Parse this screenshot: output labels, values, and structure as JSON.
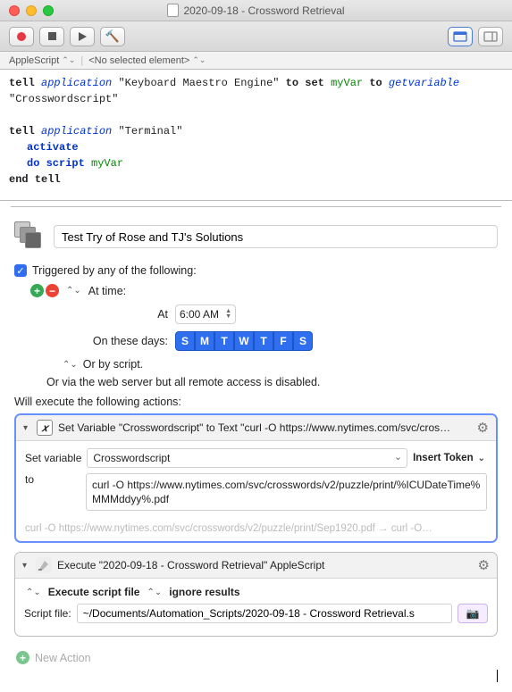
{
  "titlebar": {
    "title": "2020-09-18 - Crossword Retrieval"
  },
  "nav": {
    "language": "AppleScript",
    "element": "<No selected element>"
  },
  "script": {
    "l1_tell": "tell",
    "l1_app": "application",
    "l1_q": "\"Keyboard Maestro Engine\"",
    "l1_to": "to set",
    "l1_var": "myVar",
    "l1_to2": "to",
    "l1_getvar": "getvariable",
    "l1_q2": "\"Crosswordscript\"",
    "l3_tell": "tell",
    "l3_app": "application",
    "l3_q": "\"Terminal\"",
    "l4_activate": "activate",
    "l5_do": "do script",
    "l5_var": "myVar",
    "l6_end": "end tell"
  },
  "macro": {
    "name": "Test Try of Rose and TJ's Solutions",
    "triggered_label": "Triggered by any of the following:",
    "at_time_label": "At time:",
    "at_label": "At",
    "time_value": "6:00 AM",
    "days_label": "On these days:",
    "days": [
      "S",
      "M",
      "T",
      "W",
      "T",
      "F",
      "S"
    ],
    "or_script_label": "Or by script.",
    "web_label": "Or via the web server but all remote access is disabled.",
    "will_execute": "Will execute the following actions:"
  },
  "action1": {
    "title": "Set Variable \"Crosswordscript\" to Text \"curl -O https://www.nytimes.com/svc/cros…",
    "set_var_label": "Set variable",
    "var_name": "Crosswordscript",
    "insert_token": "Insert Token",
    "to_label": "to",
    "text_value": "curl -O https://www.nytimes.com/svc/crosswords/v2/puzzle/print/%ICUDateTime%MMMddyy%.pdf",
    "preview_left": "curl -O https://www.nytimes.com/svc/crosswords/v2/puzzle/print/Sep1920.pdf",
    "preview_right": "curl -O…"
  },
  "action2": {
    "title": "Execute \"2020-09-18 - Crossword Retrieval\" AppleScript",
    "execute_label": "Execute script file",
    "results_label": "ignore results",
    "file_label": "Script file:",
    "file_value": "~/Documents/Automation_Scripts/2020-09-18 - Crossword Retrieval.s"
  },
  "new_action": "New Action"
}
